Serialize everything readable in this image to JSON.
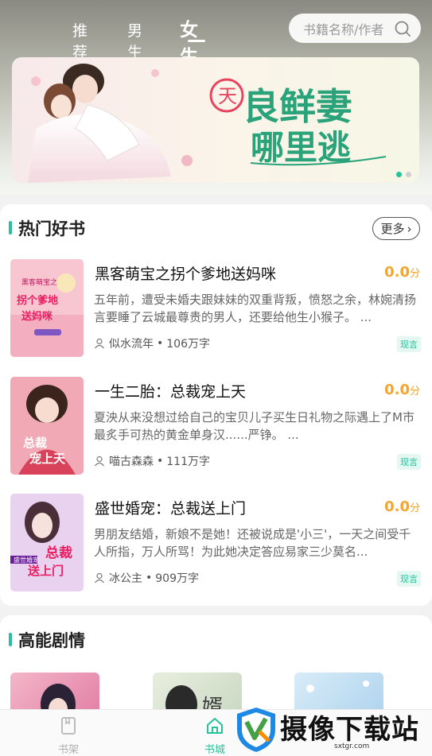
{
  "header": {
    "tabs": [
      {
        "label": "推荐",
        "active": false
      },
      {
        "label": "男生",
        "active": false
      },
      {
        "label": "女生",
        "active": true
      }
    ],
    "search_placeholder": "书籍名称/作者"
  },
  "banner": {
    "title_line1": "良鲜妻",
    "title_line2": "哪里逃",
    "title_prefix": "天",
    "slide_index": 1,
    "slide_count": 2
  },
  "hot": {
    "title": "热门好书",
    "more_label": "更多",
    "books": [
      {
        "title": "黑客萌宝之拐个爹地送妈咪",
        "score": "0.0",
        "score_unit": "分",
        "desc": "五年前，遭受未婚夫跟妹妹的双重背叛，愤怒之余，林婉清扬言要睡了云城最尊贵的男人，还要给他生小猴子。 ...",
        "author": "似水流年",
        "words": "106万字",
        "genre": "现言",
        "cover_text": "拐个爹地送妈咪",
        "cover_tag": "黑客萌宝之"
      },
      {
        "title": "一生二胎：总裁宠上天",
        "score": "0.0",
        "score_unit": "分",
        "desc": "夏泱从来没想过给自己的宝贝儿子买生日礼物之际遇上了M市最炙手可热的黄金单身汉......严铮。 ...",
        "author": "喵古森森",
        "words": "111万字",
        "genre": "现言",
        "cover_text": "总裁宠上天",
        "cover_tag": ""
      },
      {
        "title": "盛世婚宠：总裁送上门",
        "score": "0.0",
        "score_unit": "分",
        "desc": "男朋友结婚，新娘不是她！还被说成是'小三'，一天之间受千人所指，万人所骂！为此她决定答应易家三少莫名...",
        "author": "冰公主",
        "words": "909万字",
        "genre": "现言",
        "cover_text": "总裁送上门",
        "cover_tag": "盛世婚宠"
      }
    ]
  },
  "high": {
    "title": "高能剧情"
  },
  "nav": {
    "items": [
      {
        "label": "书架",
        "active": false
      },
      {
        "label": "书城",
        "active": true
      }
    ]
  },
  "watermark": {
    "text": "摄像下载站",
    "url": "sxtgr.com"
  },
  "colors": {
    "accent": "#26c29a",
    "score": "#f5a52b"
  }
}
